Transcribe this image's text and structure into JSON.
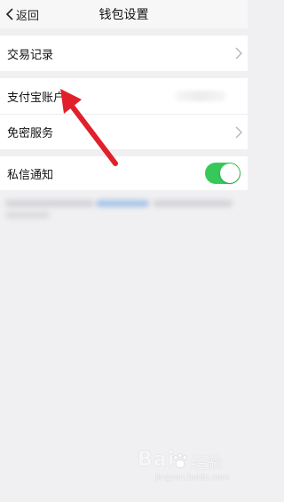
{
  "header": {
    "back_label": "返回",
    "title": "钱包设置"
  },
  "settings": {
    "transactions": "交易记录",
    "alipay_account": "支付宝账户",
    "password_free": "免密服务",
    "dm_notify": "私信通知",
    "dm_notify_enabled": true
  },
  "colors": {
    "toggle_on": "#36c95a",
    "annotation_arrow": "#e0202a"
  },
  "watermark": {
    "logo": "Bai",
    "logo_suffix": "经验",
    "url": "jingyan.baidu.com"
  }
}
